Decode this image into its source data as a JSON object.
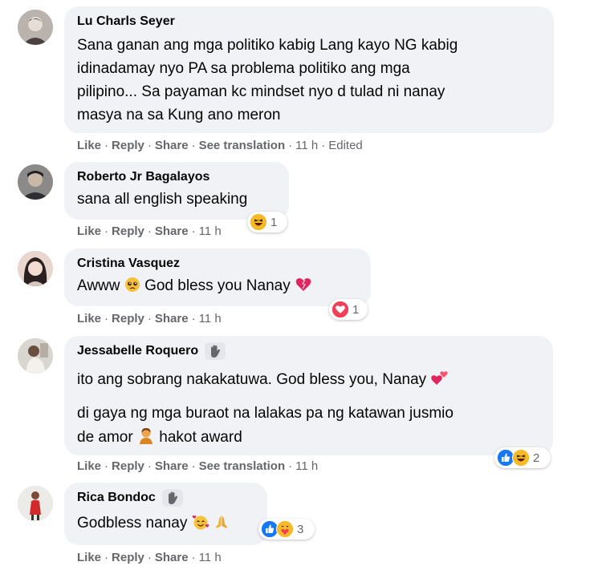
{
  "comments": [
    {
      "author": "Lu Charls Seyer",
      "lines": [
        "Sana ganan ang mga politiko kabig Lang kayo NG kabig",
        "idinadamay nyo PA sa problema politiko ang mga",
        "pilipino... Sa payaman kc mindset nyo d tulad ni nanay",
        "masya na sa Kung ano meron"
      ],
      "actions": {
        "like": "Like",
        "reply": "Reply",
        "share": "Share",
        "translate": "See translation",
        "time": "11 h",
        "edited": "Edited"
      }
    },
    {
      "author": "Roberto Jr Bagalayos",
      "lines": [
        "sana all english speaking"
      ],
      "reaction_count": "1",
      "actions": {
        "like": "Like",
        "reply": "Reply",
        "share": "Share",
        "time": "11 h"
      }
    },
    {
      "author": "Cristina Vasquez",
      "text_before": "Awww",
      "text_after": "God bless you Nanay",
      "reaction_count": "1",
      "actions": {
        "like": "Like",
        "reply": "Reply",
        "share": "Share",
        "time": "11 h"
      }
    },
    {
      "author": "Jessabelle Roquero",
      "line1": "ito ang sobrang nakakatuwa. God bless you, Nanay",
      "line2": "di gaya ng mga buraot na lalakas pa ng katawan jusmio",
      "line3a": "de amor",
      "line3b": "hakot award",
      "reaction_count": "2",
      "actions": {
        "like": "Like",
        "reply": "Reply",
        "share": "Share",
        "translate": "See translation",
        "time": "11 h"
      }
    },
    {
      "author": "Rica Bondoc",
      "text": "Godbless nanay",
      "reaction_count": "3",
      "actions": {
        "like": "Like",
        "reply": "Reply",
        "share": "Share",
        "time": "11 h"
      }
    }
  ],
  "icons": {
    "like": "like-reaction-icon",
    "haha": "haha-reaction-icon",
    "love": "love-reaction-icon",
    "care": "care-reaction-icon",
    "fan_badge": "waving-hand-badge-icon"
  },
  "colors": {
    "bubble": "#f0f2f5",
    "meta_text": "#65676b",
    "like_blue": "#1877f2",
    "love_red": "#f33e58",
    "haha_yellow": "#f7b928"
  }
}
